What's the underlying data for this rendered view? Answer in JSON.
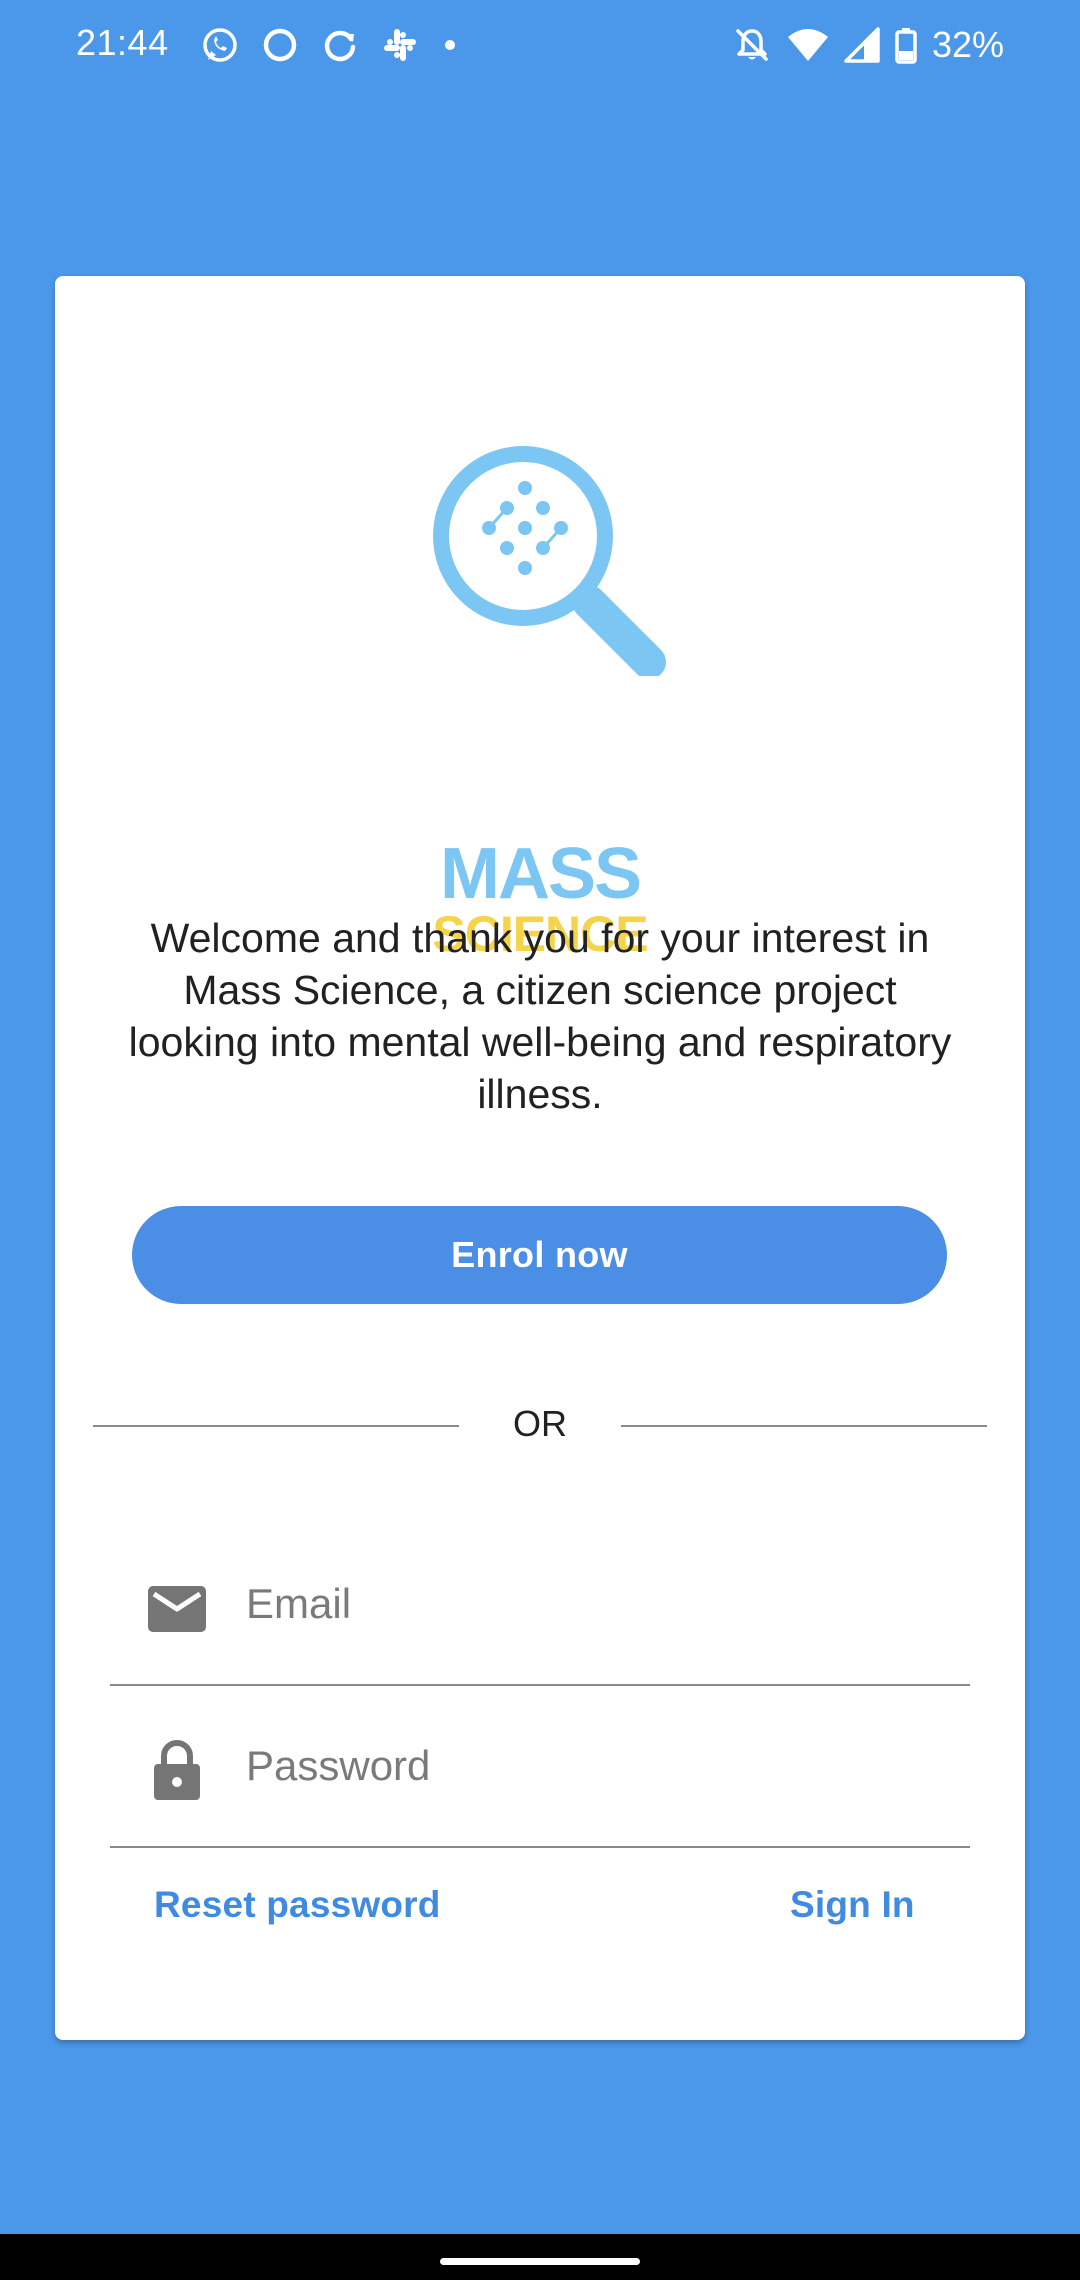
{
  "status_bar": {
    "time": "21:44",
    "battery": "32%",
    "left_icons": [
      "whatsapp-icon",
      "circle-app-icon",
      "sync-icon",
      "slack-icon",
      "dot-icon"
    ],
    "right_icons": [
      "notifications-off-icon",
      "wifi-icon",
      "signal-icon",
      "battery-icon"
    ]
  },
  "logo": {
    "line1": "MASS",
    "line2": "SCIENCE",
    "icon": "magnifier-dots-icon",
    "colors": {
      "blue": "#7cc6f3",
      "yellow": "#f5d44a"
    }
  },
  "welcome_text": "Welcome and thank you for your interest in Mass Science, a citizen science project looking into mental well-being  and respiratory illness.",
  "enrol_button": "Enrol now",
  "divider_text": "OR",
  "email": {
    "placeholder": "Email",
    "value": "",
    "icon": "email-icon"
  },
  "password": {
    "placeholder": "Password",
    "value": "",
    "icon": "lock-icon"
  },
  "reset_password": "Reset password",
  "sign_in": "Sign In",
  "colors": {
    "background": "#4b97ea",
    "button": "#4b8ee6",
    "link": "#3f8be0"
  }
}
